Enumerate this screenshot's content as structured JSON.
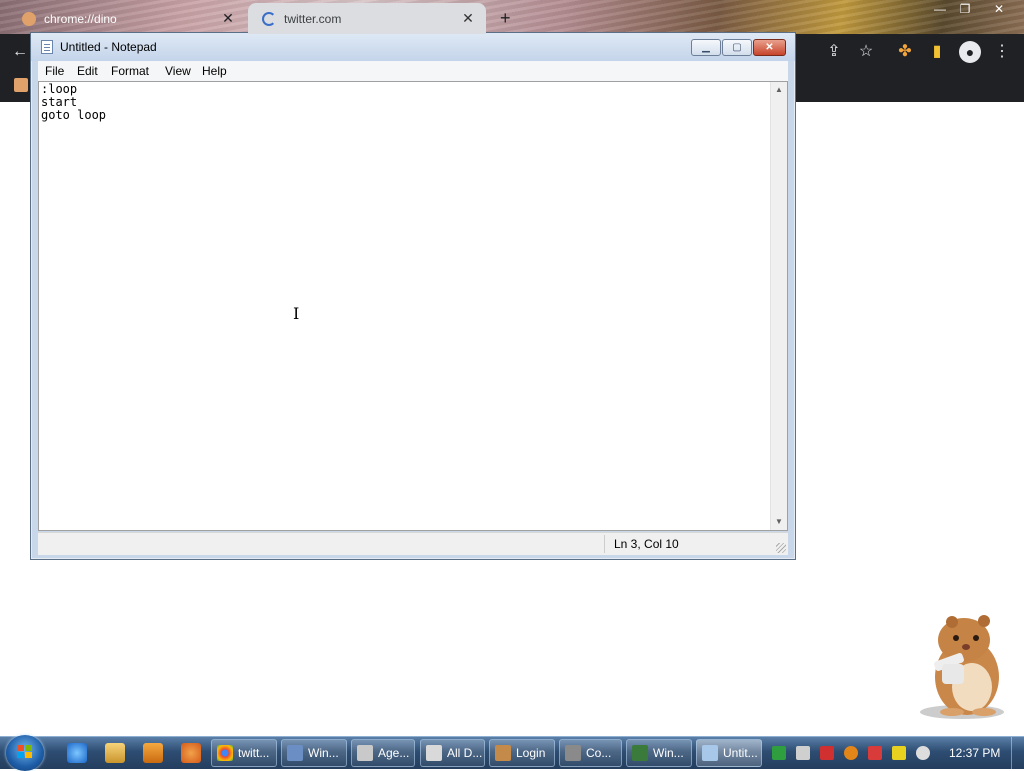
{
  "browser": {
    "tabs": [
      {
        "title": "chrome://dino",
        "active": false
      },
      {
        "title": "twitter.com",
        "active": true
      }
    ],
    "new_tab": "+",
    "close_glyph": "✕",
    "toolbar_icons": [
      "back-arrow-icon",
      "share-icon",
      "star-icon",
      "extensions-icon",
      "sidebar-icon",
      "profile-icon",
      "menu-kebab-icon"
    ]
  },
  "notepad": {
    "title": "Untitled - Notepad",
    "buttons": {
      "minimize": "▁",
      "maximize": "▢",
      "close": "✕"
    },
    "menu": {
      "file": "File",
      "edit": "Edit",
      "format": "Format",
      "view": "View",
      "help": "Help"
    },
    "content": ":loop\nstart\ngoto loop",
    "status": {
      "position": "Ln 3, Col 10"
    },
    "scroll": {
      "up": "▲",
      "down": "▼"
    }
  },
  "cursor": "I",
  "taskbar": {
    "pinned_icons": [
      "internet-explorer-icon",
      "file-explorer-icon",
      "media-player-icon",
      "app-icon"
    ],
    "buttons": [
      {
        "label": "twitt...",
        "icon": "chrome-icon",
        "color": "#e94235"
      },
      {
        "label": "Win...",
        "icon": "window-icon",
        "color": "#6b8fc4"
      },
      {
        "label": "Age...",
        "icon": "agent-icon",
        "color": "#c9c9c9"
      },
      {
        "label": "All D...",
        "icon": "folder-icon",
        "color": "#d9d9d9"
      },
      {
        "label": "Login",
        "icon": "login-icon",
        "color": "#c48a4a"
      },
      {
        "label": "Co...",
        "icon": "console-icon",
        "color": "#8a8a8a"
      },
      {
        "label": "Win...",
        "icon": "terminal-icon",
        "color": "#3a7a3a"
      },
      {
        "label": "Untit...",
        "icon": "notepad-icon",
        "color": "#a8c8ea"
      }
    ],
    "tray_colors": [
      "#2e9e3e",
      "#cfcfcf",
      "#d03030",
      "#e2861a",
      "#d93b3b",
      "#e8d21f",
      "#dddddd"
    ],
    "clock": "12:37 PM"
  }
}
